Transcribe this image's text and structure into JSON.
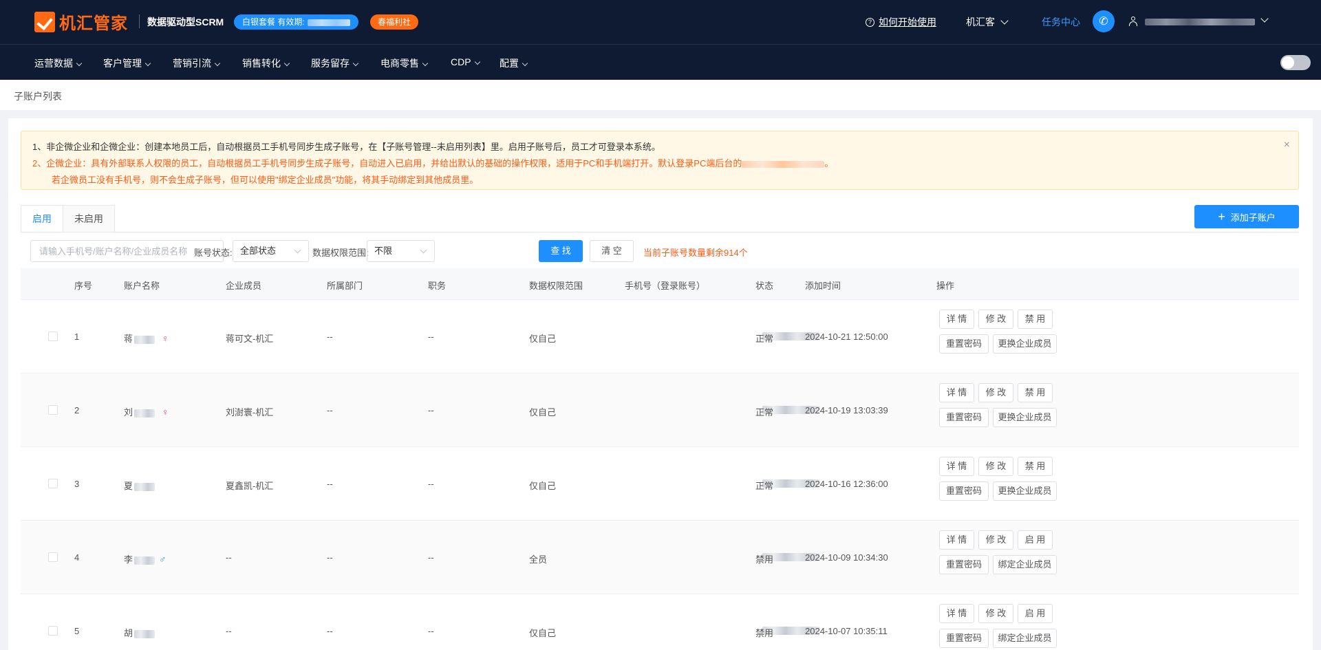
{
  "header": {
    "logo_text": "机汇管家",
    "slogan": "数据驱动型SCRM",
    "package_badge": "白银套餐 有效期:",
    "welfare_badge": "春福利社",
    "help_link": "如何开始使用",
    "org_name": "机汇客",
    "task_center": "任务中心"
  },
  "nav": {
    "items": [
      "运营数据",
      "客户管理",
      "营销引流",
      "销售转化",
      "服务留存",
      "电商零售",
      "CDP",
      "配置"
    ]
  },
  "breadcrumb": {
    "title": "子账户列表"
  },
  "notice": {
    "line1": "1、非企微企业和企微企业：创建本地员工后，自动根据员工手机号同步生成子账号，在【子账号管理--未启用列表】里。启用子账号后，员工才可登录本系统。",
    "line2": "2、企微企业：具有外部联系人权限的员工，自动根据员工手机号同步生成子账号，自动进入已启用，并给出默认的基础的操作权限，适用于PC和手机端打开。默认登录PC端后台的",
    "line2_tail": "。",
    "line3": "若企微员工没有手机号，则不会生成子账号，但可以使用\"绑定企业成员\"功能，将其手动绑定到其他成员里。",
    "close": "×"
  },
  "tabs": [
    {
      "label": "启用"
    },
    {
      "label": "未启用"
    }
  ],
  "toolbar": {
    "add_button": "添加子账户",
    "search_placeholder": "请输入手机号/账户名称/企业成员名称",
    "status_label": "账号状态:",
    "status_value": "全部状态",
    "scope_label": "数据权限范围:",
    "scope_value": "不限",
    "search_button": "查 找",
    "clear_button": "清 空",
    "quota_text": "当前子账号数量剩余914个"
  },
  "table": {
    "columns": [
      "序号",
      "账户名称",
      "企业成员",
      "所属部门",
      "职务",
      "数据权限范围",
      "手机号（登录账号）",
      "状态",
      "添加时间",
      "操作"
    ],
    "rows": [
      {
        "no": "1",
        "name": "蒋",
        "gender": "♀",
        "member": "蒋可文-机汇",
        "dept": "--",
        "title": "--",
        "scope": "仅自己",
        "status": "正常",
        "time": "2024-10-21 12:50:00",
        "ops": [
          "详 情",
          "修 改",
          "禁 用",
          "重置密码",
          "更换企业成员"
        ]
      },
      {
        "no": "2",
        "name": "刘",
        "gender": "♀",
        "member": "刘澍寰-机汇",
        "dept": "--",
        "title": "--",
        "scope": "仅自己",
        "status": "正常",
        "time": "2024-10-19 13:03:39",
        "ops": [
          "详 情",
          "修 改",
          "禁 用",
          "重置密码",
          "更换企业成员"
        ]
      },
      {
        "no": "3",
        "name": "夏",
        "gender": "",
        "member": "夏鑫凯-机汇",
        "dept": "--",
        "title": "--",
        "scope": "仅自己",
        "status": "正常",
        "time": "2024-10-16 12:36:00",
        "ops": [
          "详 情",
          "修 改",
          "禁 用",
          "重置密码",
          "更换企业成员"
        ]
      },
      {
        "no": "4",
        "name": "李",
        "gender": "♂",
        "member": "--",
        "dept": "--",
        "title": "--",
        "scope": "全员",
        "status": "禁用",
        "time": "2024-10-09 10:34:30",
        "ops": [
          "详 情",
          "修 改",
          "启 用",
          "重置密码",
          "绑定企业成员"
        ]
      },
      {
        "no": "5",
        "name": "胡",
        "gender": "",
        "member": "--",
        "dept": "--",
        "title": "--",
        "scope": "仅自己",
        "status": "禁用",
        "time": "2024-10-07 10:35:11",
        "ops": [
          "详 情",
          "修 改",
          "启 用",
          "重置密码",
          "绑定企业成员"
        ]
      }
    ]
  },
  "colors": {
    "brand_orange": "#ff6a13",
    "primary_blue": "#1e8fff",
    "header_bg": "#0f1b33"
  }
}
